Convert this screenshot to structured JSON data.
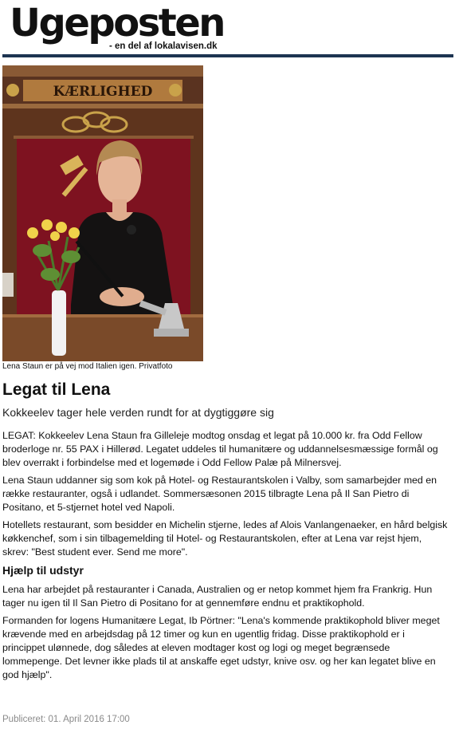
{
  "masthead": {
    "logo": "Ugeposten",
    "tagline": "- en del af lokalavisen.dk"
  },
  "image": {
    "banner_text": "KÆRLIGHED",
    "caption": "Lena Staun er på vej mod Italien igen. Privatfoto"
  },
  "article": {
    "headline": "Legat til Lena",
    "subheadline": "Kokkeelev tager hele verden rundt for at dygtiggøre sig",
    "paragraphs": [
      "LEGAT: Kokkeelev Lena Staun fra Gilleleje modtog onsdag et legat på 10.000 kr. fra Odd Fellow broderloge nr. 55 PAX i Hillerød. Legatet uddeles til humanitære og uddannelsesmæssige formål og blev overrakt i forbindelse med et logemøde i Odd Fellow Palæ på Milnersvej.",
      "Lena Staun uddanner sig som kok på Hotel- og Restaurantskolen i Valby, som samarbejder med en række restauranter, også i udlandet. Sommersæsonen 2015 tilbragte Lena på Il San Pietro di Positano, et 5-stjernet hotel ved Napoli.",
      "Hotellets restaurant, som besidder en Michelin stjerne, ledes af Alois Vanlangenaeker, en hård belgisk køkkenchef, som i sin tilbagemelding til Hotel- og Restaurantskolen, efter at Lena var rejst hjem, skrev: \"Best student ever. Send me more\"."
    ],
    "section_heading": "Hjælp til udstyr",
    "paragraphs_2": [
      "Lena har arbejdet på restauranter i Canada, Australien og er netop kommet hjem fra Frankrig. Hun tager nu igen til Il San Pietro di Positano for at gennemføre endnu et praktikophold.",
      "Formanden for logens Humanitære Legat, Ib Pörtner: \"Lena's kommende praktikophold bliver meget krævende med en arbejdsdag på 12 timer og kun en ugentlig fridag. Disse praktikophold er i princippet ulønnede, dog således at eleven modtager kost og logi og meget begrænsede lommepenge. Det levner ikke plads til at anskaffe eget udstyr, knive osv. og her kan legatet blive en god hjælp\"."
    ],
    "published": "Publiceret: 01. April 2016 17:00"
  },
  "colors": {
    "rule": "#1d3451",
    "published_text": "#8a8a8a",
    "wood": "#6b3d22",
    "red_panel": "#7e1220",
    "gold": "#c9a24a"
  }
}
